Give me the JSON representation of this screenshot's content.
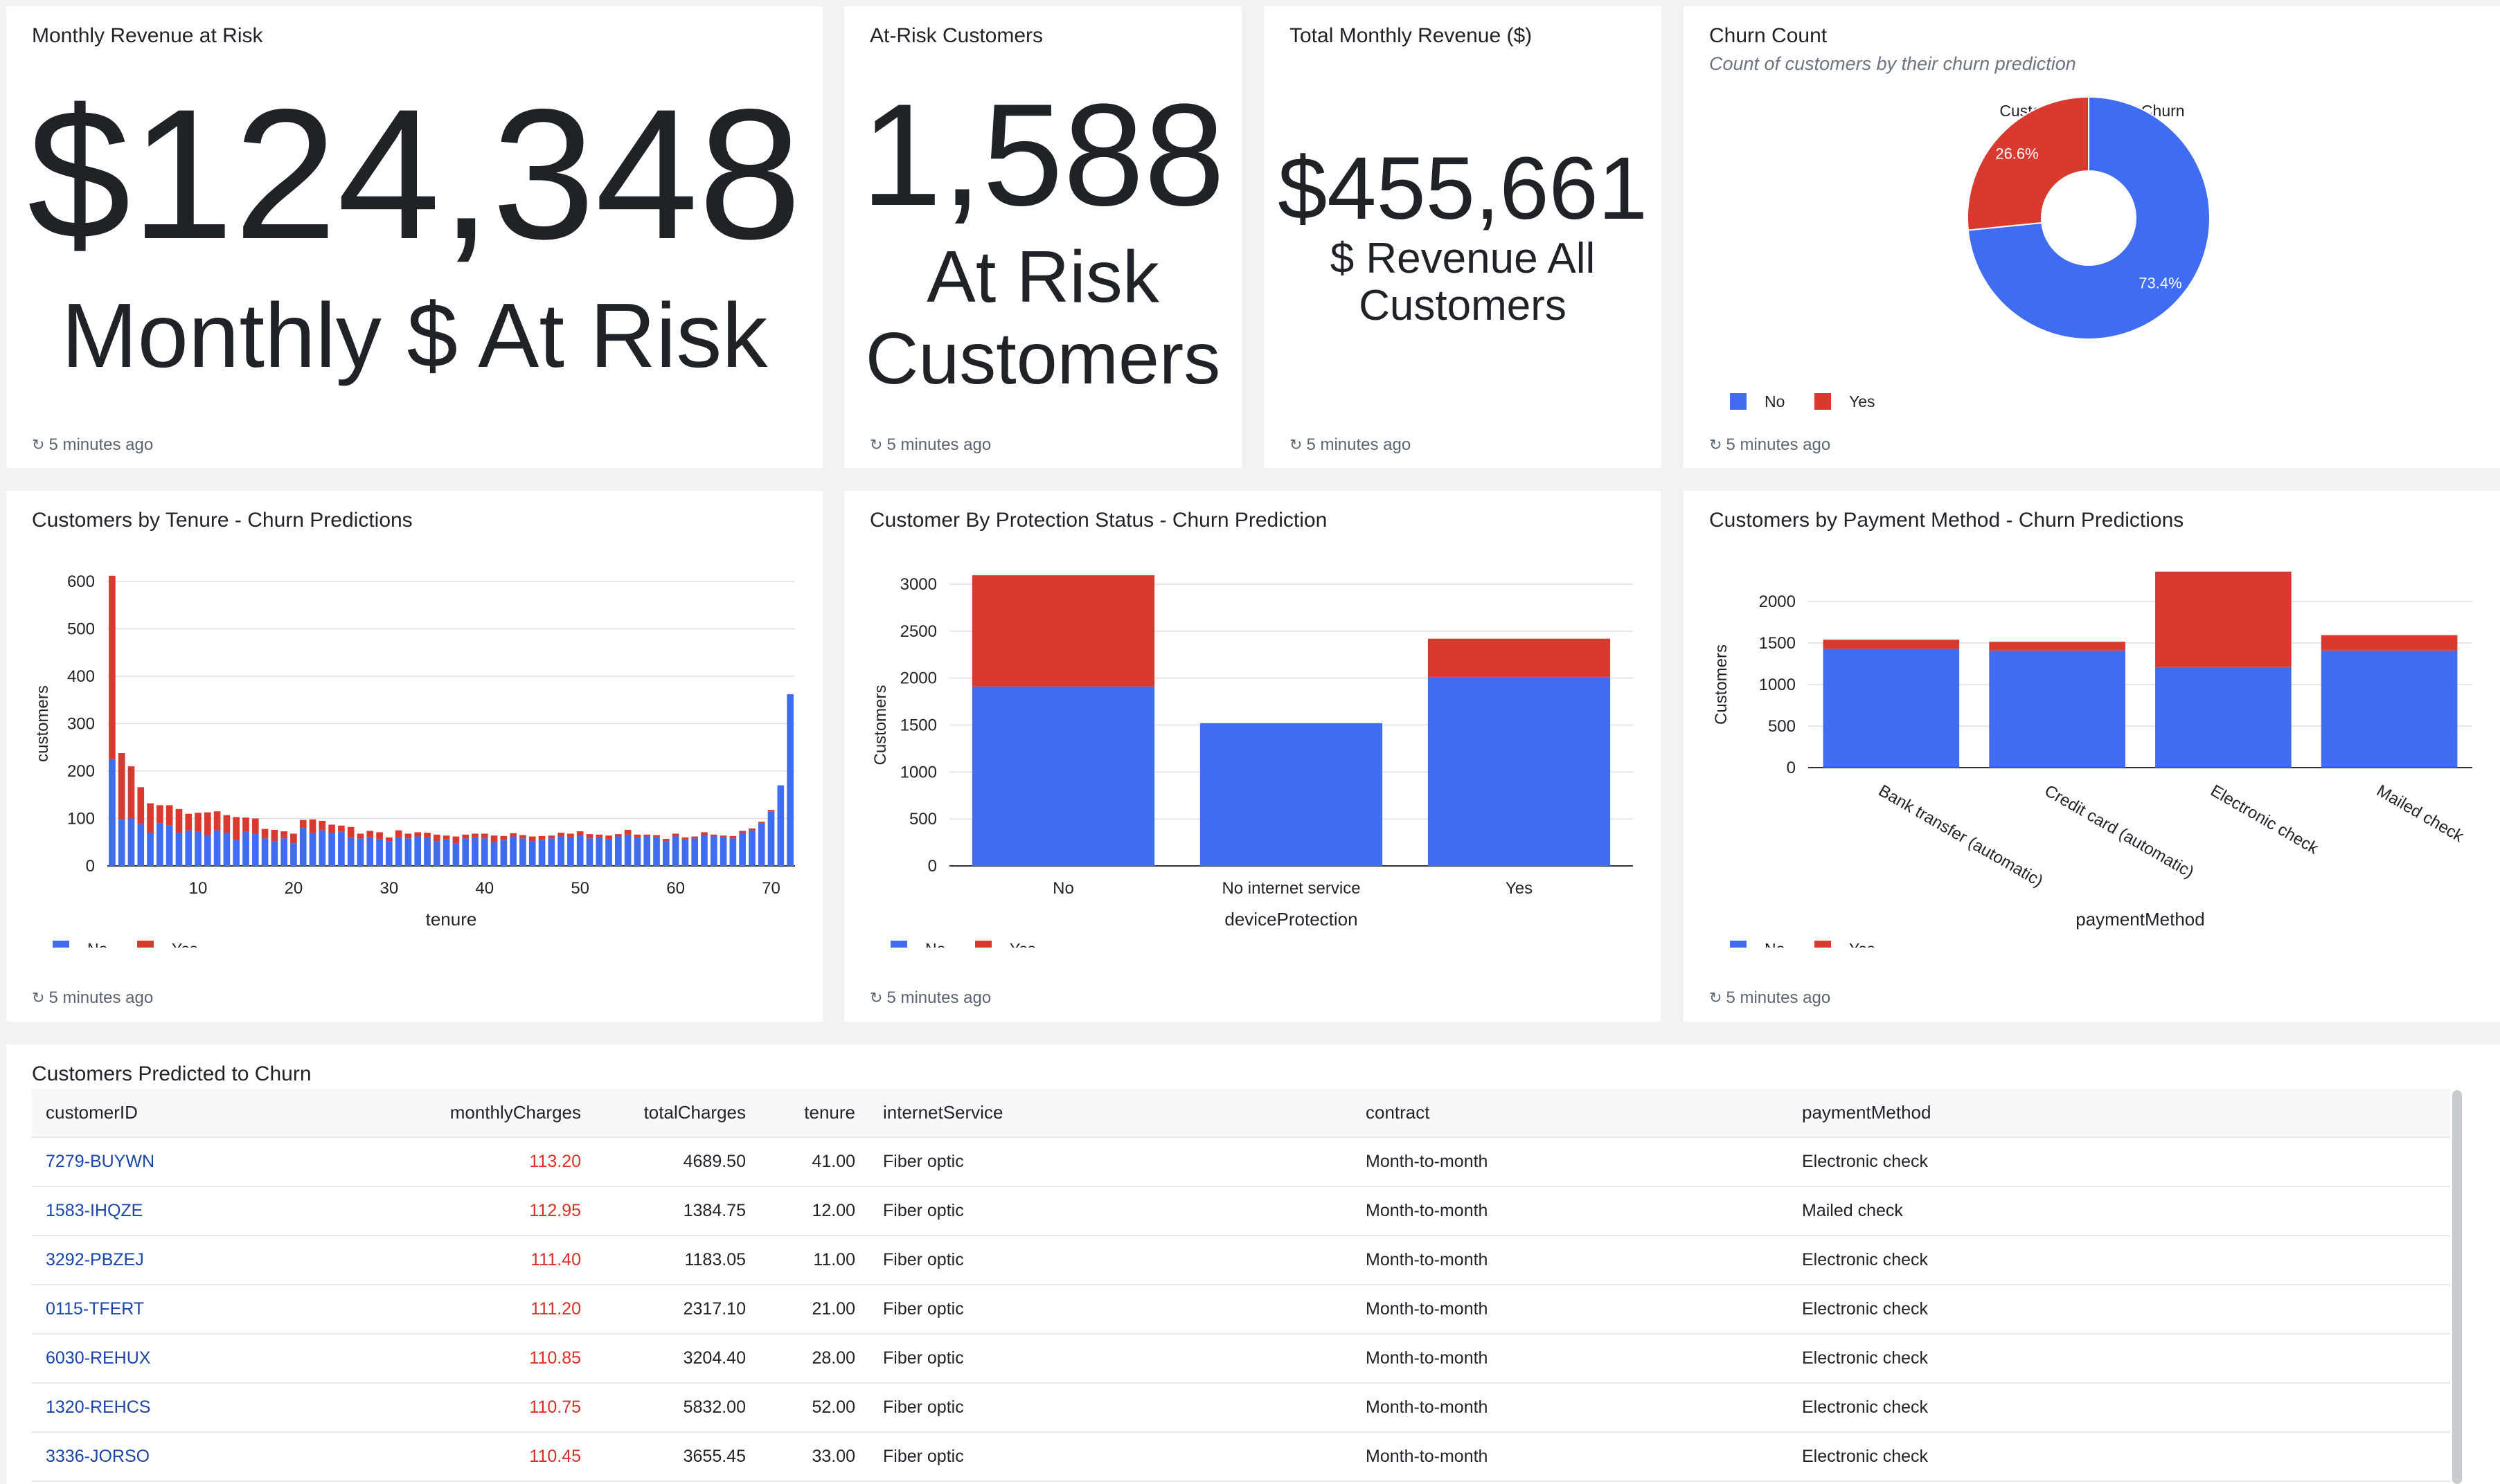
{
  "refresh_label": "5 minutes ago",
  "colors": {
    "no": "#3f6cf0",
    "yes": "#d93a30",
    "link": "#1a44a8",
    "negative": "#d93025"
  },
  "cards": {
    "revenue_at_risk": {
      "title": "Monthly Revenue at Risk",
      "value": "$124,348",
      "label": "Monthly $ At Risk"
    },
    "at_risk_customers": {
      "title": "At-Risk Customers",
      "value": "1,588",
      "label_line1": "At Risk",
      "label_line2": "Customers"
    },
    "total_revenue": {
      "title": "Total Monthly Revenue ($)",
      "value": "$455,661",
      "label_line1": "$ Revenue All",
      "label_line2": "Customers"
    },
    "churn_count": {
      "title": "Churn Count",
      "subtitle": "Count of customers by their churn prediction"
    },
    "tenure": {
      "title": "Customers by Tenure - Churn Predictions"
    },
    "protection": {
      "title": "Customer By Protection Status - Churn Prediction"
    },
    "payment": {
      "title": "Customers by Payment Method - Churn Predictions"
    }
  },
  "chart_data": [
    {
      "type": "pie",
      "title": "Customer Count by Churn",
      "categories": [
        "No",
        "Yes"
      ],
      "values": [
        73.4,
        26.6
      ],
      "labels": [
        "73.4%",
        "26.6%"
      ],
      "donut": true,
      "legend": "bottom-left"
    },
    {
      "type": "bar",
      "stacked": true,
      "xlabel": "tenure",
      "ylabel": "customers",
      "ylim": [
        0,
        600
      ],
      "yticks": [
        "0",
        "100",
        "200",
        "300",
        "400",
        "500",
        "600"
      ],
      "xticks": [
        "10",
        "20",
        "30",
        "40",
        "50",
        "60",
        "70"
      ],
      "x": [
        1,
        2,
        3,
        4,
        5,
        6,
        7,
        8,
        9,
        10,
        11,
        12,
        13,
        14,
        15,
        16,
        17,
        18,
        19,
        20,
        21,
        22,
        23,
        24,
        25,
        26,
        27,
        28,
        29,
        30,
        31,
        32,
        33,
        34,
        35,
        36,
        37,
        38,
        39,
        40,
        41,
        42,
        43,
        44,
        45,
        46,
        47,
        48,
        49,
        50,
        51,
        52,
        53,
        54,
        55,
        56,
        57,
        58,
        59,
        60,
        61,
        62,
        63,
        64,
        65,
        66,
        67,
        68,
        69,
        70,
        71,
        72
      ],
      "series": [
        {
          "name": "No",
          "values": [
            225,
            98,
            100,
            88,
            70,
            90,
            85,
            70,
            75,
            72,
            65,
            75,
            70,
            55,
            72,
            68,
            58,
            52,
            58,
            48,
            80,
            70,
            75,
            70,
            72,
            60,
            58,
            60,
            56,
            52,
            60,
            58,
            62,
            60,
            52,
            56,
            48,
            58,
            60,
            58,
            50,
            55,
            62,
            58,
            52,
            55,
            58,
            62,
            60,
            65,
            58,
            60,
            56,
            62,
            66,
            60,
            62,
            60,
            52,
            62,
            56,
            58,
            65,
            62,
            60,
            58,
            70,
            75,
            90,
            115,
            170,
            362
          ]
        },
        {
          "name": "Yes",
          "values": [
            387,
            140,
            110,
            78,
            62,
            38,
            43,
            50,
            35,
            40,
            48,
            40,
            37,
            48,
            30,
            32,
            20,
            24,
            15,
            20,
            17,
            28,
            20,
            17,
            13,
            22,
            10,
            14,
            15,
            8,
            15,
            10,
            9,
            10,
            14,
            8,
            14,
            8,
            8,
            10,
            14,
            8,
            7,
            7,
            10,
            8,
            6,
            8,
            8,
            8,
            9,
            6,
            8,
            5,
            10,
            6,
            4,
            5,
            5,
            6,
            4,
            4,
            6,
            4,
            4,
            5,
            4,
            4,
            3,
            3,
            0,
            0
          ]
        }
      ],
      "legend": "bottom-left"
    },
    {
      "type": "bar",
      "stacked": true,
      "xlabel": "deviceProtection",
      "ylabel": "Customers",
      "ylim": [
        0,
        3000
      ],
      "yticks": [
        "0",
        "500",
        "1000",
        "1500",
        "2000",
        "2500",
        "3000"
      ],
      "categories": [
        "No",
        "No internet service",
        "Yes"
      ],
      "series": [
        {
          "name": "No",
          "values": [
            1910,
            1520,
            2010
          ]
        },
        {
          "name": "Yes",
          "values": [
            1185,
            0,
            410
          ]
        }
      ],
      "legend": "bottom-left"
    },
    {
      "type": "bar",
      "stacked": true,
      "xlabel": "paymentMethod",
      "ylabel": "Customers",
      "ylim": [
        0,
        2000
      ],
      "yticks": [
        "0",
        "500",
        "1000",
        "1500",
        "2000"
      ],
      "categories": [
        "Bank transfer (automatic)",
        "Credit card (automatic)",
        "Electronic check",
        "Mailed check"
      ],
      "series": [
        {
          "name": "No",
          "values": [
            1430,
            1410,
            1210,
            1410
          ]
        },
        {
          "name": "Yes",
          "values": [
            110,
            105,
            1150,
            185
          ]
        }
      ],
      "legend": "bottom-left"
    }
  ],
  "table": {
    "title": "Customers Predicted to Churn",
    "columns": [
      "customerID",
      "monthlyCharges",
      "totalCharges",
      "tenure",
      "internetService",
      "contract",
      "paymentMethod"
    ],
    "rows": [
      [
        "7279-BUYWN",
        "113.20",
        "4689.50",
        "41.00",
        "Fiber optic",
        "Month-to-month",
        "Electronic check"
      ],
      [
        "1583-IHQZE",
        "112.95",
        "1384.75",
        "12.00",
        "Fiber optic",
        "Month-to-month",
        "Mailed check"
      ],
      [
        "3292-PBZEJ",
        "111.40",
        "1183.05",
        "11.00",
        "Fiber optic",
        "Month-to-month",
        "Electronic check"
      ],
      [
        "0115-TFERT",
        "111.20",
        "2317.10",
        "21.00",
        "Fiber optic",
        "Month-to-month",
        "Electronic check"
      ],
      [
        "6030-REHUX",
        "110.85",
        "3204.40",
        "28.00",
        "Fiber optic",
        "Month-to-month",
        "Electronic check"
      ],
      [
        "1320-REHCS",
        "110.75",
        "5832.00",
        "52.00",
        "Fiber optic",
        "Month-to-month",
        "Electronic check"
      ],
      [
        "3336-JORSO",
        "110.45",
        "3655.45",
        "33.00",
        "Fiber optic",
        "Month-to-month",
        "Electronic check"
      ]
    ]
  }
}
